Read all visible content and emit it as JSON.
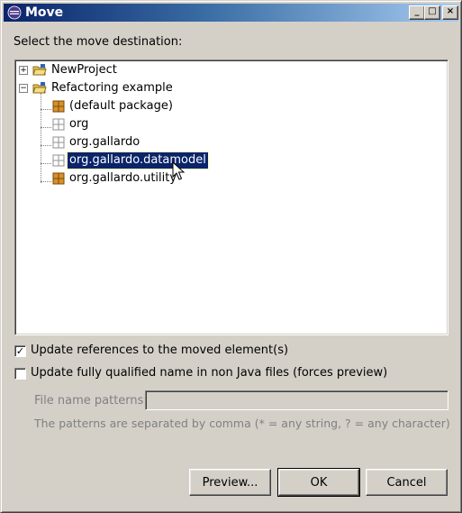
{
  "window": {
    "title": "Move"
  },
  "title_buttons": {
    "minimize": "_",
    "maximize": "□",
    "close": "×"
  },
  "prompt": "Select the move destination:",
  "tree": {
    "items": [
      {
        "label": "NewProject",
        "expanded": false,
        "icon": "project-folder-icon"
      },
      {
        "label": "Refactoring example",
        "expanded": true,
        "icon": "project-folder-icon"
      },
      {
        "label": "(default package)",
        "icon": "package-icon"
      },
      {
        "label": "org",
        "icon": "empty-package-icon"
      },
      {
        "label": "org.gallardo",
        "icon": "empty-package-icon"
      },
      {
        "label": "org.gallardo.datamodel",
        "icon": "empty-package-icon",
        "selected": true
      },
      {
        "label": "org.gallardo.utility",
        "icon": "package-icon"
      }
    ]
  },
  "options": {
    "update_refs": {
      "label": "Update references to the moved element(s)",
      "checked": true
    },
    "update_qualified": {
      "label": "Update fully qualified name in non Java files (forces preview)",
      "checked": false
    }
  },
  "file_patterns": {
    "label": "File name patterns:",
    "value": "",
    "hint": "The patterns are separated by comma (* = any string, ? = any character)"
  },
  "buttons": {
    "preview": "Preview...",
    "ok": "OK",
    "cancel": "Cancel"
  }
}
